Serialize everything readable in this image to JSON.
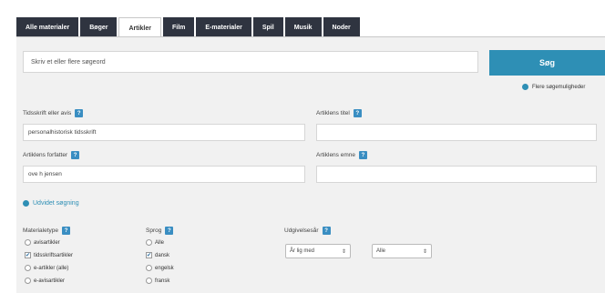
{
  "tabs": [
    {
      "label": "Alle materialer",
      "active": false
    },
    {
      "label": "Bøger",
      "active": false
    },
    {
      "label": "Artikler",
      "active": true
    },
    {
      "label": "Film",
      "active": false
    },
    {
      "label": "E-materialer",
      "active": false
    },
    {
      "label": "Spil",
      "active": false
    },
    {
      "label": "Musik",
      "active": false
    },
    {
      "label": "Noder",
      "active": false
    }
  ],
  "search": {
    "value": "Skriv et eller flere søgeord",
    "button_label": "Søg",
    "more_options_label": "Flere søgemuligheder"
  },
  "fields": {
    "journal": {
      "label": "Tidsskrift eller avis",
      "value": "personalhistorisk tidsskrift"
    },
    "title": {
      "label": "Artiklens titel",
      "value": ""
    },
    "author": {
      "label": "Artiklens forfatter",
      "value": "ove h jensen"
    },
    "subject": {
      "label": "Artiklens emne",
      "value": ""
    }
  },
  "advanced_link": "Udvidet søgning",
  "material_type": {
    "label": "Materialetype",
    "options": [
      {
        "label": "avisartikler",
        "kind": "radio",
        "checked": false
      },
      {
        "label": "tidsskriftsartikler",
        "kind": "check",
        "checked": true
      },
      {
        "label": "e-artikler (alle)",
        "kind": "radio",
        "checked": false
      },
      {
        "label": "e-avisartikler",
        "kind": "radio",
        "checked": false
      }
    ]
  },
  "language": {
    "label": "Sprog",
    "options": [
      {
        "label": "Alle",
        "kind": "radio",
        "checked": false
      },
      {
        "label": "dansk",
        "kind": "check",
        "checked": true
      },
      {
        "label": "engelsk",
        "kind": "radio",
        "checked": false
      },
      {
        "label": "fransk",
        "kind": "radio",
        "checked": false
      }
    ]
  },
  "year": {
    "label": "Udgivelsesår",
    "operator": "År lig med",
    "value": "Alle"
  },
  "colors": {
    "accent": "#2e8fb5",
    "tab_bg": "#2f3440",
    "panel_bg": "#f1f1f1"
  }
}
